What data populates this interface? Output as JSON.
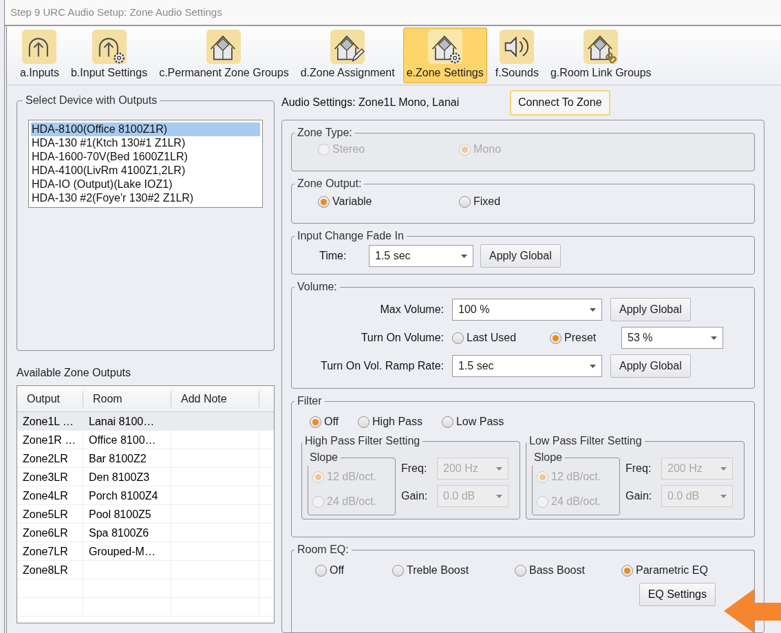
{
  "window": {
    "title": "Step 9 URC Audio Setup: Zone Audio Settings"
  },
  "tabs": [
    {
      "label": "a.Inputs",
      "kind": "input",
      "selected": false
    },
    {
      "label": "b.Input Settings",
      "kind": "input-gear",
      "selected": false
    },
    {
      "label": "c.Permanent Zone Groups",
      "kind": "house",
      "selected": false
    },
    {
      "label": "d.Zone Assignment",
      "kind": "house-pencil",
      "selected": false
    },
    {
      "label": "e.Zone Settings",
      "kind": "house-gear",
      "selected": true
    },
    {
      "label": "f.Sounds",
      "kind": "speaker",
      "selected": false
    },
    {
      "label": "g.Room Link Groups",
      "kind": "house-link",
      "selected": false
    }
  ],
  "device_group": {
    "title": "Select Device with Outputs",
    "devices": [
      {
        "label": "HDA-8100(Office 8100Z1R)",
        "selected": true
      },
      {
        "label": "HDA-130 #1(Ktch 130#1 Z1LR)",
        "selected": false
      },
      {
        "label": "HDA-1600-70V(Bed 1600Z1LR)",
        "selected": false
      },
      {
        "label": "HDA-4100(LivRm 4100Z1,2LR)",
        "selected": false
      },
      {
        "label": "HDA-IO (Output)(Lake IOZ1)",
        "selected": false
      },
      {
        "label": "HDA-130 #2(Foye'r 130#2 Z1LR)",
        "selected": false
      }
    ]
  },
  "zone_outputs": {
    "title": "Available Zone Outputs",
    "columns": [
      "Output",
      "Room",
      "Add Note"
    ],
    "rows": [
      {
        "output": "Zone1L …",
        "room": "Lanai 8100…",
        "selected": true
      },
      {
        "output": "Zone1R …",
        "room": "Office 8100…",
        "selected": false
      },
      {
        "output": "Zone2LR",
        "room": "Bar 8100Z2",
        "selected": false
      },
      {
        "output": "Zone3LR",
        "room": "Den 8100Z3",
        "selected": false
      },
      {
        "output": "Zone4LR",
        "room": "Porch 8100Z4",
        "selected": false
      },
      {
        "output": "Zone5LR",
        "room": "Pool 8100Z5",
        "selected": false
      },
      {
        "output": "Zone6LR",
        "room": "Spa 8100Z6",
        "selected": false
      },
      {
        "output": "Zone7LR",
        "room": "Grouped-M…",
        "selected": false
      },
      {
        "output": "Zone8LR",
        "selected": false
      }
    ]
  },
  "audio": {
    "heading": "Audio Settings: Zone1L Mono, Lanai",
    "connect_button": "Connect To Zone"
  },
  "zone_type": {
    "title": "Zone Type:",
    "disabled": true,
    "options": [
      {
        "label": "Stereo",
        "selected": false
      },
      {
        "label": "Mono",
        "selected": true
      }
    ]
  },
  "zone_output": {
    "title": "Zone Output:",
    "options": [
      {
        "label": "Variable",
        "selected": true
      },
      {
        "label": "Fixed",
        "selected": false
      }
    ]
  },
  "fade": {
    "title": "Input Change Fade In",
    "time_label": "Time:",
    "time_value": "1.5 sec",
    "apply_button": "Apply Global"
  },
  "volume": {
    "title": "Volume:",
    "max_label": "Max Volume:",
    "max_value": "100 %",
    "max_apply": "Apply Global",
    "turn_on_label": "Turn On Volume:",
    "turn_on_options": [
      {
        "label": "Last Used",
        "selected": false
      },
      {
        "label": "Preset",
        "selected": true
      }
    ],
    "preset_value": "53 %",
    "ramp_label": "Turn On Vol. Ramp Rate:",
    "ramp_value": "1.5 sec",
    "ramp_apply": "Apply Global"
  },
  "filter": {
    "title": "Filter",
    "options": [
      {
        "label": "Off",
        "selected": true
      },
      {
        "label": "High Pass",
        "selected": false
      },
      {
        "label": "Low Pass",
        "selected": false
      }
    ],
    "settings": [
      {
        "title": "High Pass Filter Setting",
        "disabled": true,
        "slope_title": "Slope",
        "slopes": [
          {
            "label": "12 dB/oct.",
            "selected": true
          },
          {
            "label": "24 dB/oct.",
            "selected": false
          }
        ],
        "freq_label": "Freq:",
        "freq_value": "200 Hz",
        "gain_label": "Gain:",
        "gain_value": "0.0 dB"
      },
      {
        "title": "Low Pass Filter Setting",
        "disabled": true,
        "slope_title": "Slope",
        "slopes": [
          {
            "label": "12 dB/oct.",
            "selected": true
          },
          {
            "label": "24 dB/oct.",
            "selected": false
          }
        ],
        "freq_label": "Freq:",
        "freq_value": "200 Hz",
        "gain_label": "Gain:",
        "gain_value": "0.0 dB"
      }
    ]
  },
  "room_eq": {
    "title": "Room EQ:",
    "options": [
      {
        "label": "Off",
        "selected": false
      },
      {
        "label": "Treble Boost",
        "selected": false
      },
      {
        "label": "Bass Boost",
        "selected": false
      },
      {
        "label": "Parametric EQ",
        "selected": true
      }
    ],
    "eq_button": "EQ Settings"
  }
}
